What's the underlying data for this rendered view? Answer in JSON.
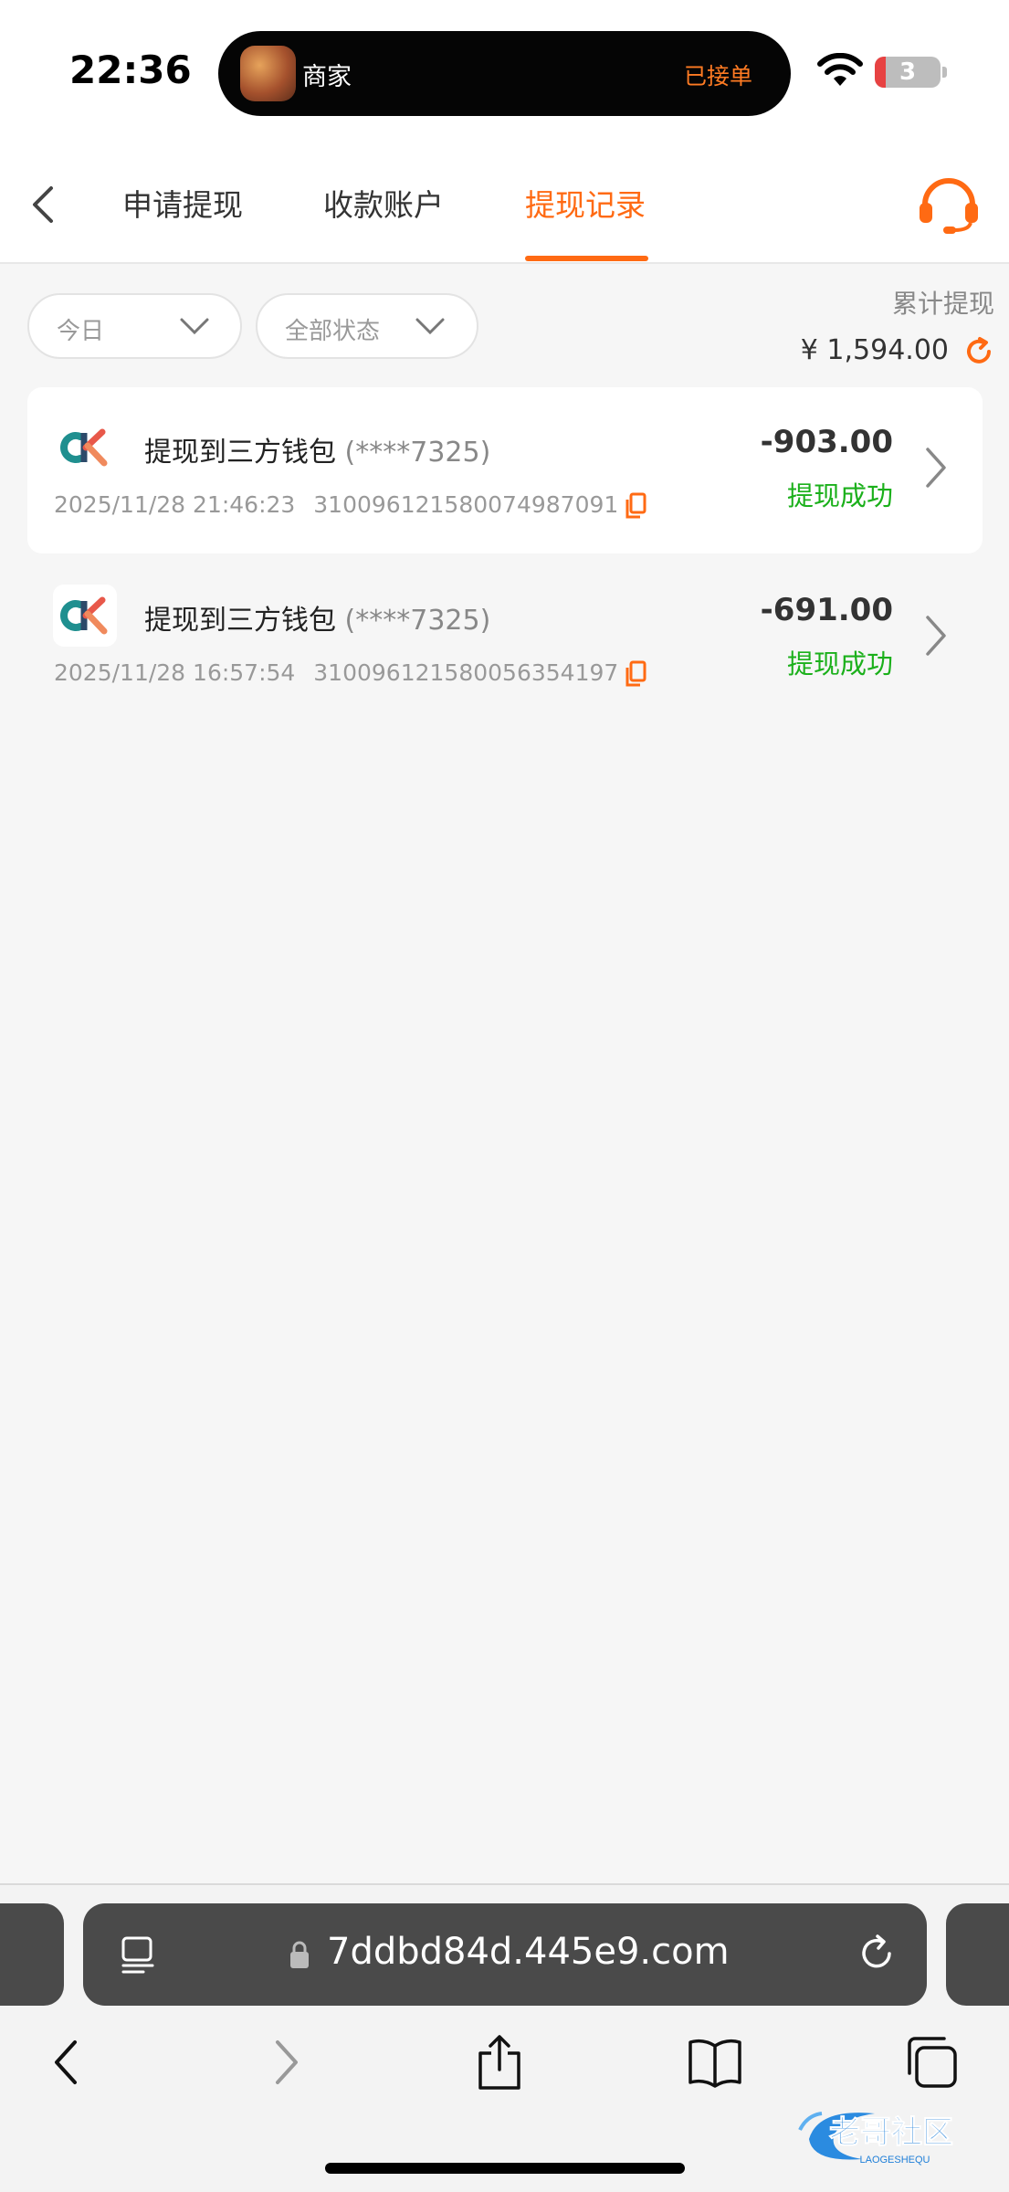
{
  "status_bar": {
    "time": "22:36",
    "island": {
      "app_name": "商家",
      "status": "已接单"
    },
    "battery": "3"
  },
  "nav": {
    "tabs": [
      {
        "label": "申请提现",
        "active": false
      },
      {
        "label": "收款账户",
        "active": false
      },
      {
        "label": "提现记录",
        "active": true
      }
    ]
  },
  "filters": {
    "date": "今日",
    "status": "全部状态"
  },
  "summary": {
    "label": "累计提现",
    "total": "¥ 1,594.00"
  },
  "records": [
    {
      "title": "提现到三方钱包",
      "account": "(****7325)",
      "datetime": "2025/11/28 21:46:23",
      "order_no": "310096121580074987091",
      "amount": "-903.00",
      "status": "提现成功"
    },
    {
      "title": "提现到三方钱包",
      "account": "(****7325)",
      "datetime": "2025/11/28 16:57:54",
      "order_no": "310096121580056354197",
      "amount": "-691.00",
      "status": "提现成功"
    }
  ],
  "browser": {
    "url": "7ddbd84d.445e9.com"
  },
  "watermark": {
    "text": "老哥社区",
    "subtext": "LAOGESHEQU"
  },
  "colors": {
    "accent": "#ff6a13",
    "success": "#1bb01b",
    "background": "#f6f6f6"
  }
}
